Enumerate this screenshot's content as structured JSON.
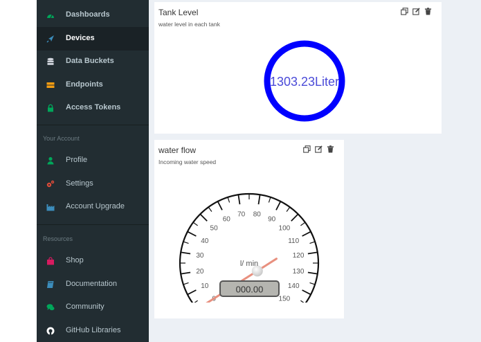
{
  "sidebar": {
    "main": [
      {
        "label": "Dashboards",
        "icon": "dashboard-icon",
        "color": "#00a65a"
      },
      {
        "label": "Devices",
        "icon": "rocket-icon",
        "color": "#3c8dbc"
      },
      {
        "label": "Data Buckets",
        "icon": "database-icon",
        "color": "#d2d6de"
      },
      {
        "label": "Endpoints",
        "icon": "server-icon",
        "color": "#f39c12"
      },
      {
        "label": "Access Tokens",
        "icon": "lock-icon",
        "color": "#00a65a"
      }
    ],
    "account_label": "Your Account",
    "account": [
      {
        "label": "Profile",
        "icon": "user-icon",
        "color": "#00a65a"
      },
      {
        "label": "Settings",
        "icon": "gears-icon",
        "color": "#dd4b39"
      },
      {
        "label": "Account Upgrade",
        "icon": "industry-icon",
        "color": "#3c8dbc"
      }
    ],
    "resources_label": "Resources",
    "resources": [
      {
        "label": "Shop",
        "icon": "shopping-bag-icon",
        "color": "#d81b60"
      },
      {
        "label": "Documentation",
        "icon": "book-icon",
        "color": "#3c8dbc"
      },
      {
        "label": "Community",
        "icon": "comments-icon",
        "color": "#00a65a"
      },
      {
        "label": "GitHub Libraries",
        "icon": "github-icon",
        "color": "#ffffff"
      }
    ]
  },
  "tank_widget": {
    "title": "Tank Level",
    "subtitle": "water level in each tank",
    "value": "1303.23Liter",
    "ring_color": "#0000ff"
  },
  "flow_widget": {
    "title": "water flow",
    "subtitle": "Incoming water speed",
    "unit": "l/ min",
    "readout": "000.00",
    "gauge_min": 0,
    "gauge_max": 150,
    "gauge_labels": [
      "0",
      "10",
      "20",
      "30",
      "40",
      "50",
      "60",
      "70",
      "80",
      "90",
      "100",
      "110",
      "120",
      "130",
      "140",
      "150"
    ],
    "needle_value": 120
  }
}
